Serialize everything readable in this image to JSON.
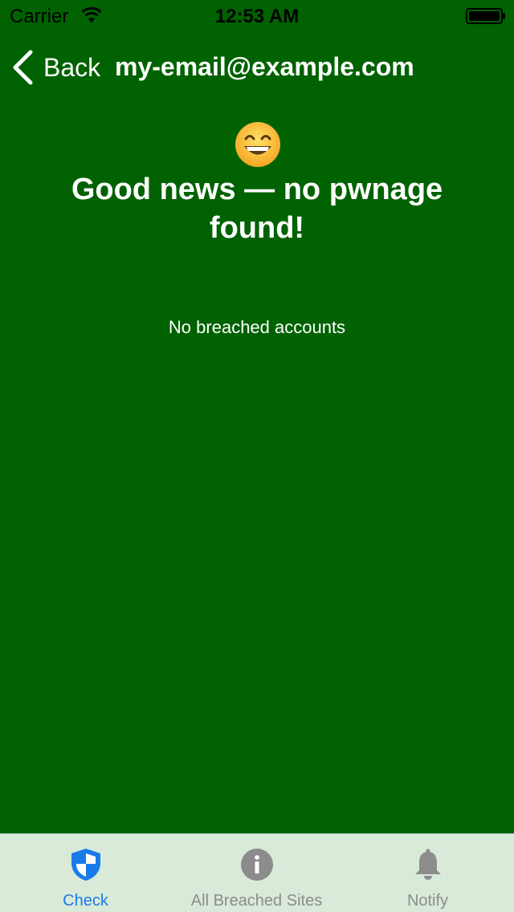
{
  "status_bar": {
    "carrier": "Carrier",
    "time": "12:53 AM"
  },
  "nav": {
    "back_label": "Back",
    "title": "my-email@example.com"
  },
  "result": {
    "emoji": "grinning-face",
    "headline": "Good news — no pwnage found!",
    "message": "No breached accounts"
  },
  "tabs": [
    {
      "label": "Check",
      "icon": "shield-icon",
      "selected": true
    },
    {
      "label": "All Breached Sites",
      "icon": "info-icon",
      "selected": false
    },
    {
      "label": "Notify",
      "icon": "bell-icon",
      "selected": false
    }
  ],
  "colors": {
    "background": "#006200",
    "tab_bar": "#d9ead9",
    "tab_active": "#1a7be8",
    "tab_inactive": "#8c8c8c"
  }
}
